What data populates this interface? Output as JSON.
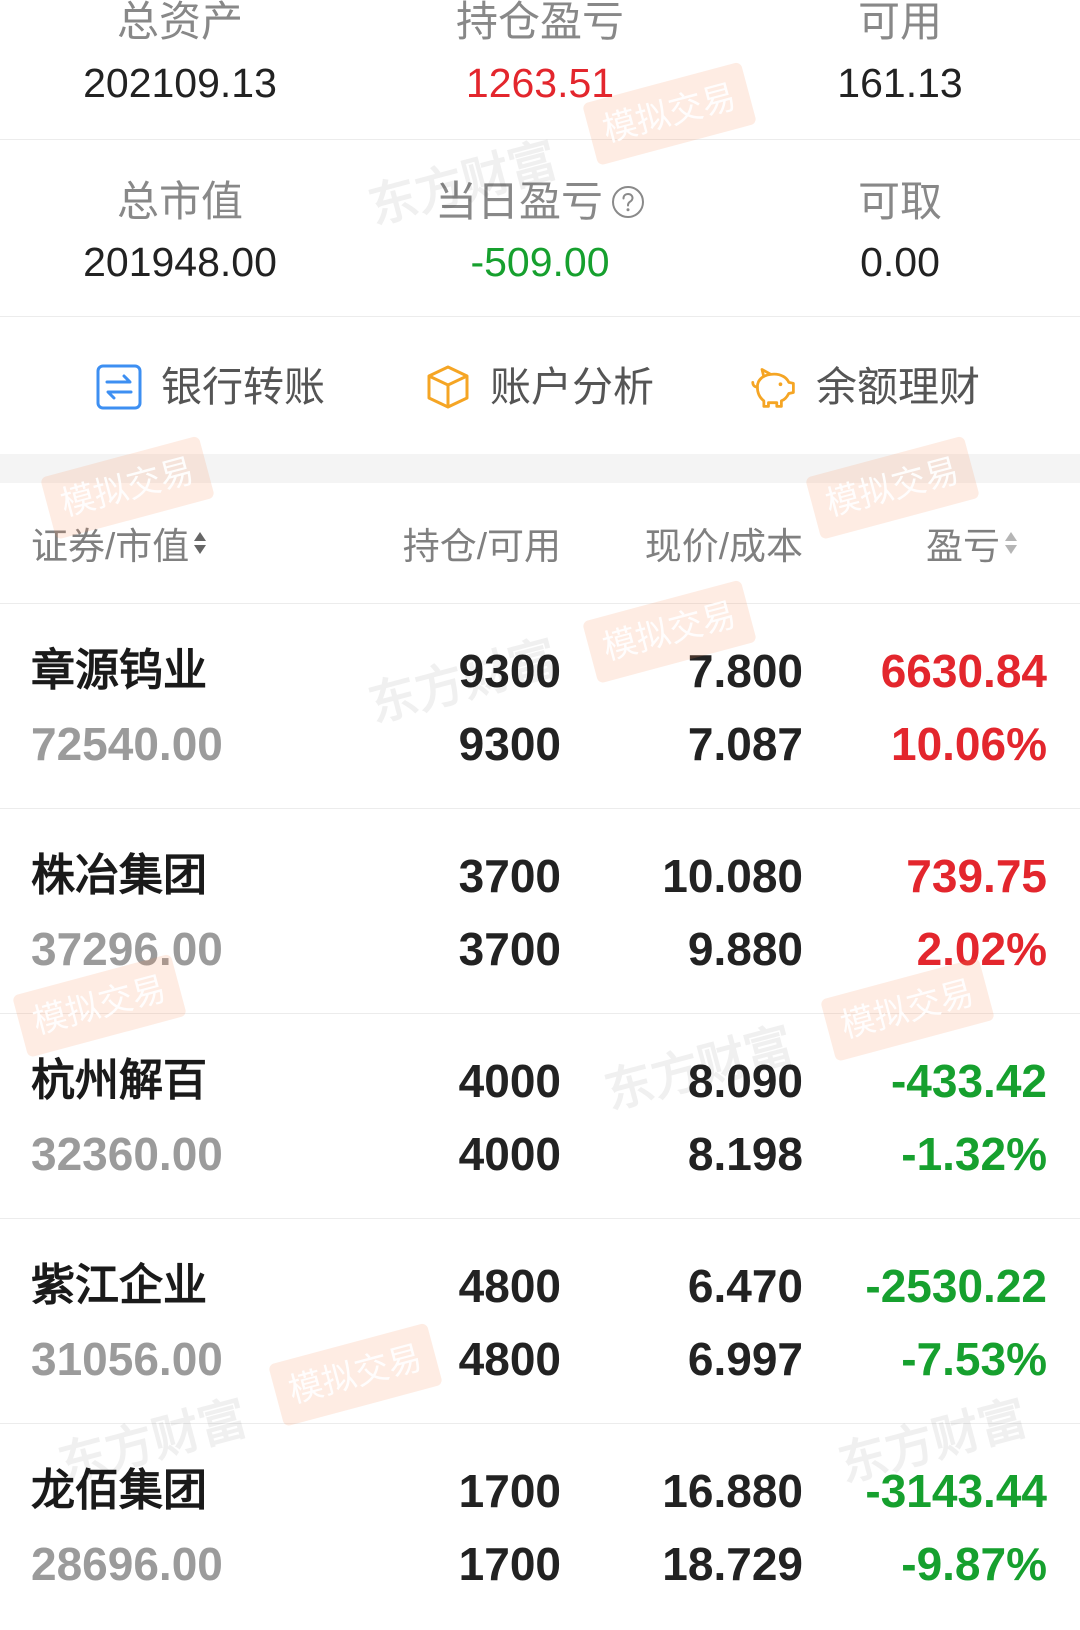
{
  "summary": [
    {
      "label": "总资产",
      "value": "202109.13",
      "tone": "neutral"
    },
    {
      "label": "持仓盈亏",
      "value": "1263.51",
      "tone": "up"
    },
    {
      "label": "可用",
      "value": "161.13",
      "tone": "neutral"
    },
    {
      "label": "总市值",
      "value": "201948.00",
      "tone": "neutral"
    },
    {
      "label": "当日盈亏",
      "value": "-509.00",
      "tone": "down",
      "icon": "question-circle-icon"
    },
    {
      "label": "可取",
      "value": "0.00",
      "tone": "neutral"
    }
  ],
  "actions": [
    {
      "label": "银行转账",
      "icon": "bank-transfer-icon"
    },
    {
      "label": "账户分析",
      "icon": "cube-icon"
    },
    {
      "label": "余额理财",
      "icon": "piggy-bank-icon"
    }
  ],
  "table": {
    "headers": [
      {
        "label": "证券/市值",
        "sortable": true
      },
      {
        "label": "持仓/可用",
        "sortable": false
      },
      {
        "label": "现价/成本",
        "sortable": false
      },
      {
        "label": "盈亏",
        "sortable": true
      }
    ],
    "positions": [
      {
        "name": "章源钨业",
        "market_value": "72540.00",
        "holding": "9300",
        "available": "9300",
        "price": "7.800",
        "cost": "7.087",
        "pnl": "6630.84",
        "pnl_pct": "10.06%",
        "tone": "up"
      },
      {
        "name": "株冶集团",
        "market_value": "37296.00",
        "holding": "3700",
        "available": "3700",
        "price": "10.080",
        "cost": "9.880",
        "pnl": "739.75",
        "pnl_pct": "2.02%",
        "tone": "up"
      },
      {
        "name": "杭州解百",
        "market_value": "32360.00",
        "holding": "4000",
        "available": "4000",
        "price": "8.090",
        "cost": "8.198",
        "pnl": "-433.42",
        "pnl_pct": "-1.32%",
        "tone": "down"
      },
      {
        "name": "紫江企业",
        "market_value": "31056.00",
        "holding": "4800",
        "available": "4800",
        "price": "6.470",
        "cost": "6.997",
        "pnl": "-2530.22",
        "pnl_pct": "-7.53%",
        "tone": "down"
      },
      {
        "name": "龙佰集团",
        "market_value": "28696.00",
        "holding": "1700",
        "available": "1700",
        "price": "16.880",
        "cost": "18.729",
        "pnl": "-3143.44",
        "pnl_pct": "-9.87%",
        "tone": "down"
      }
    ]
  },
  "watermark": {
    "brand": "东方财富",
    "badge": "模拟交易"
  },
  "colors": {
    "up": "#e3262d",
    "down": "#16a02e",
    "neutral": "#222222",
    "label": "#888888",
    "accent_blue": "#3d8ff2",
    "accent_orange": "#f5a524"
  }
}
